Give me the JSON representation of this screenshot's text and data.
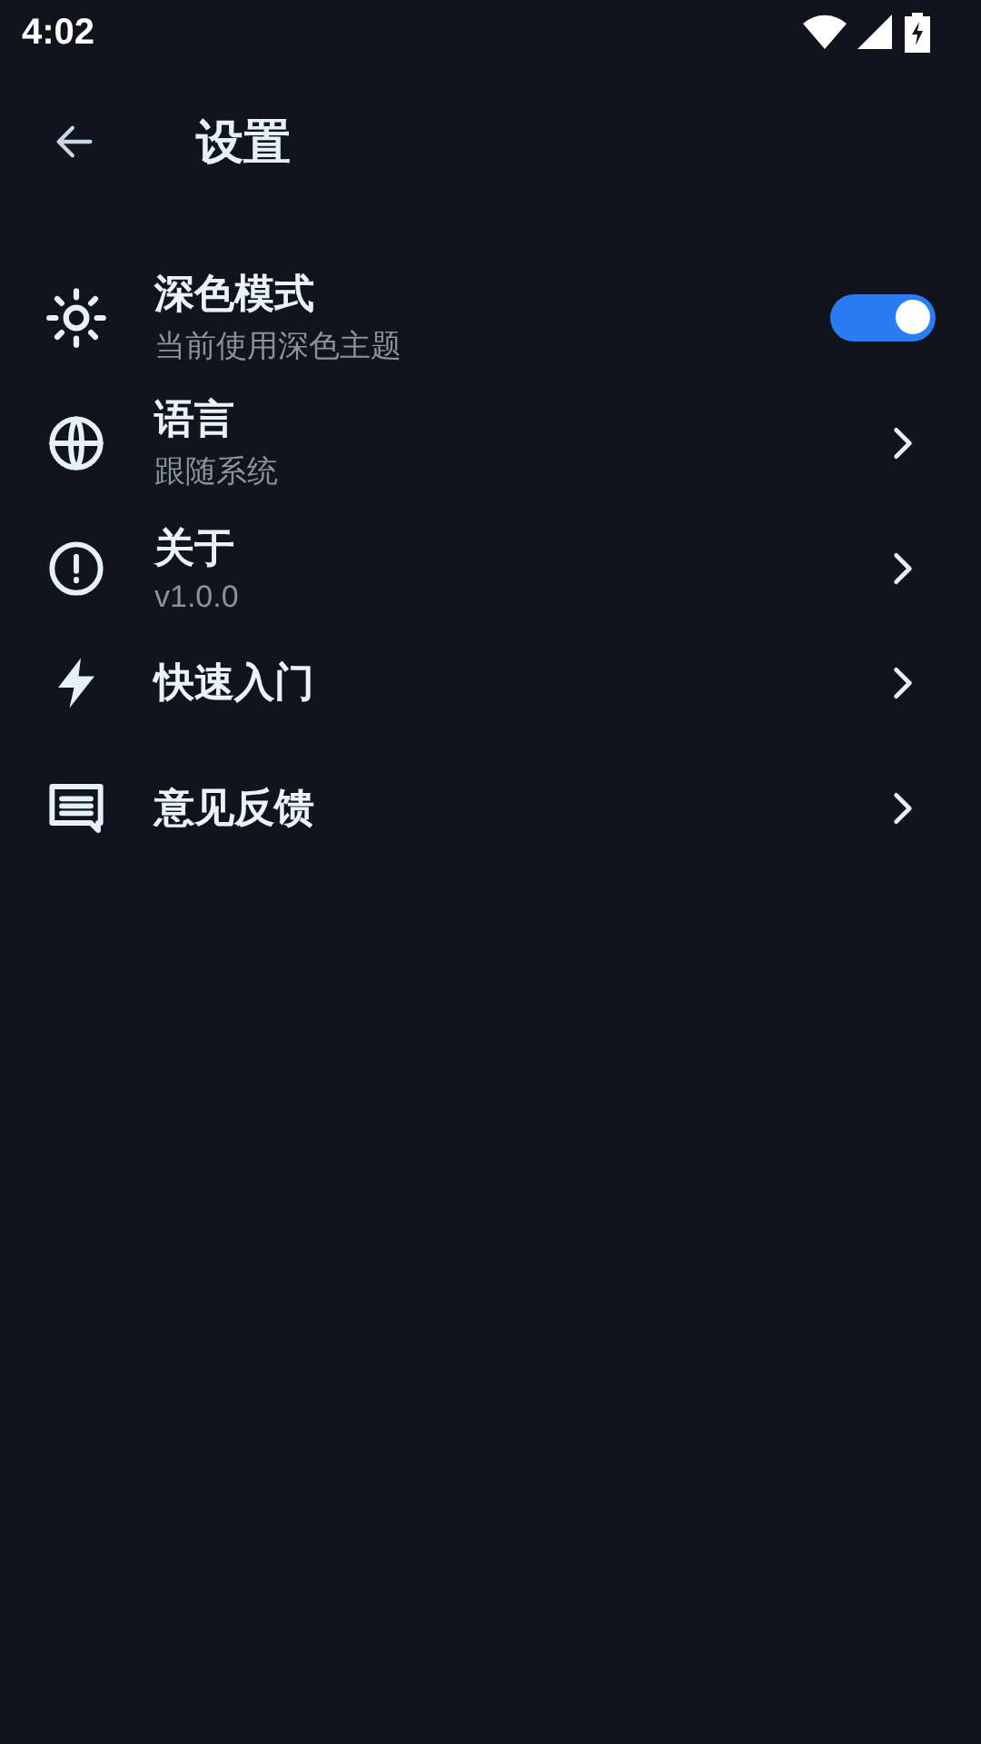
{
  "status_bar": {
    "time": "4:02"
  },
  "header": {
    "title": "设置"
  },
  "items": [
    {
      "kind": "toggle",
      "title": "深色模式",
      "subtitle": "当前使用深色主题",
      "on": true
    },
    {
      "kind": "link",
      "title": "语言",
      "subtitle": "跟随系统"
    },
    {
      "kind": "link",
      "title": "关于",
      "subtitle": "v1.0.0"
    },
    {
      "kind": "link",
      "title": "快速入门"
    },
    {
      "kind": "link",
      "title": "意见反馈"
    }
  ]
}
